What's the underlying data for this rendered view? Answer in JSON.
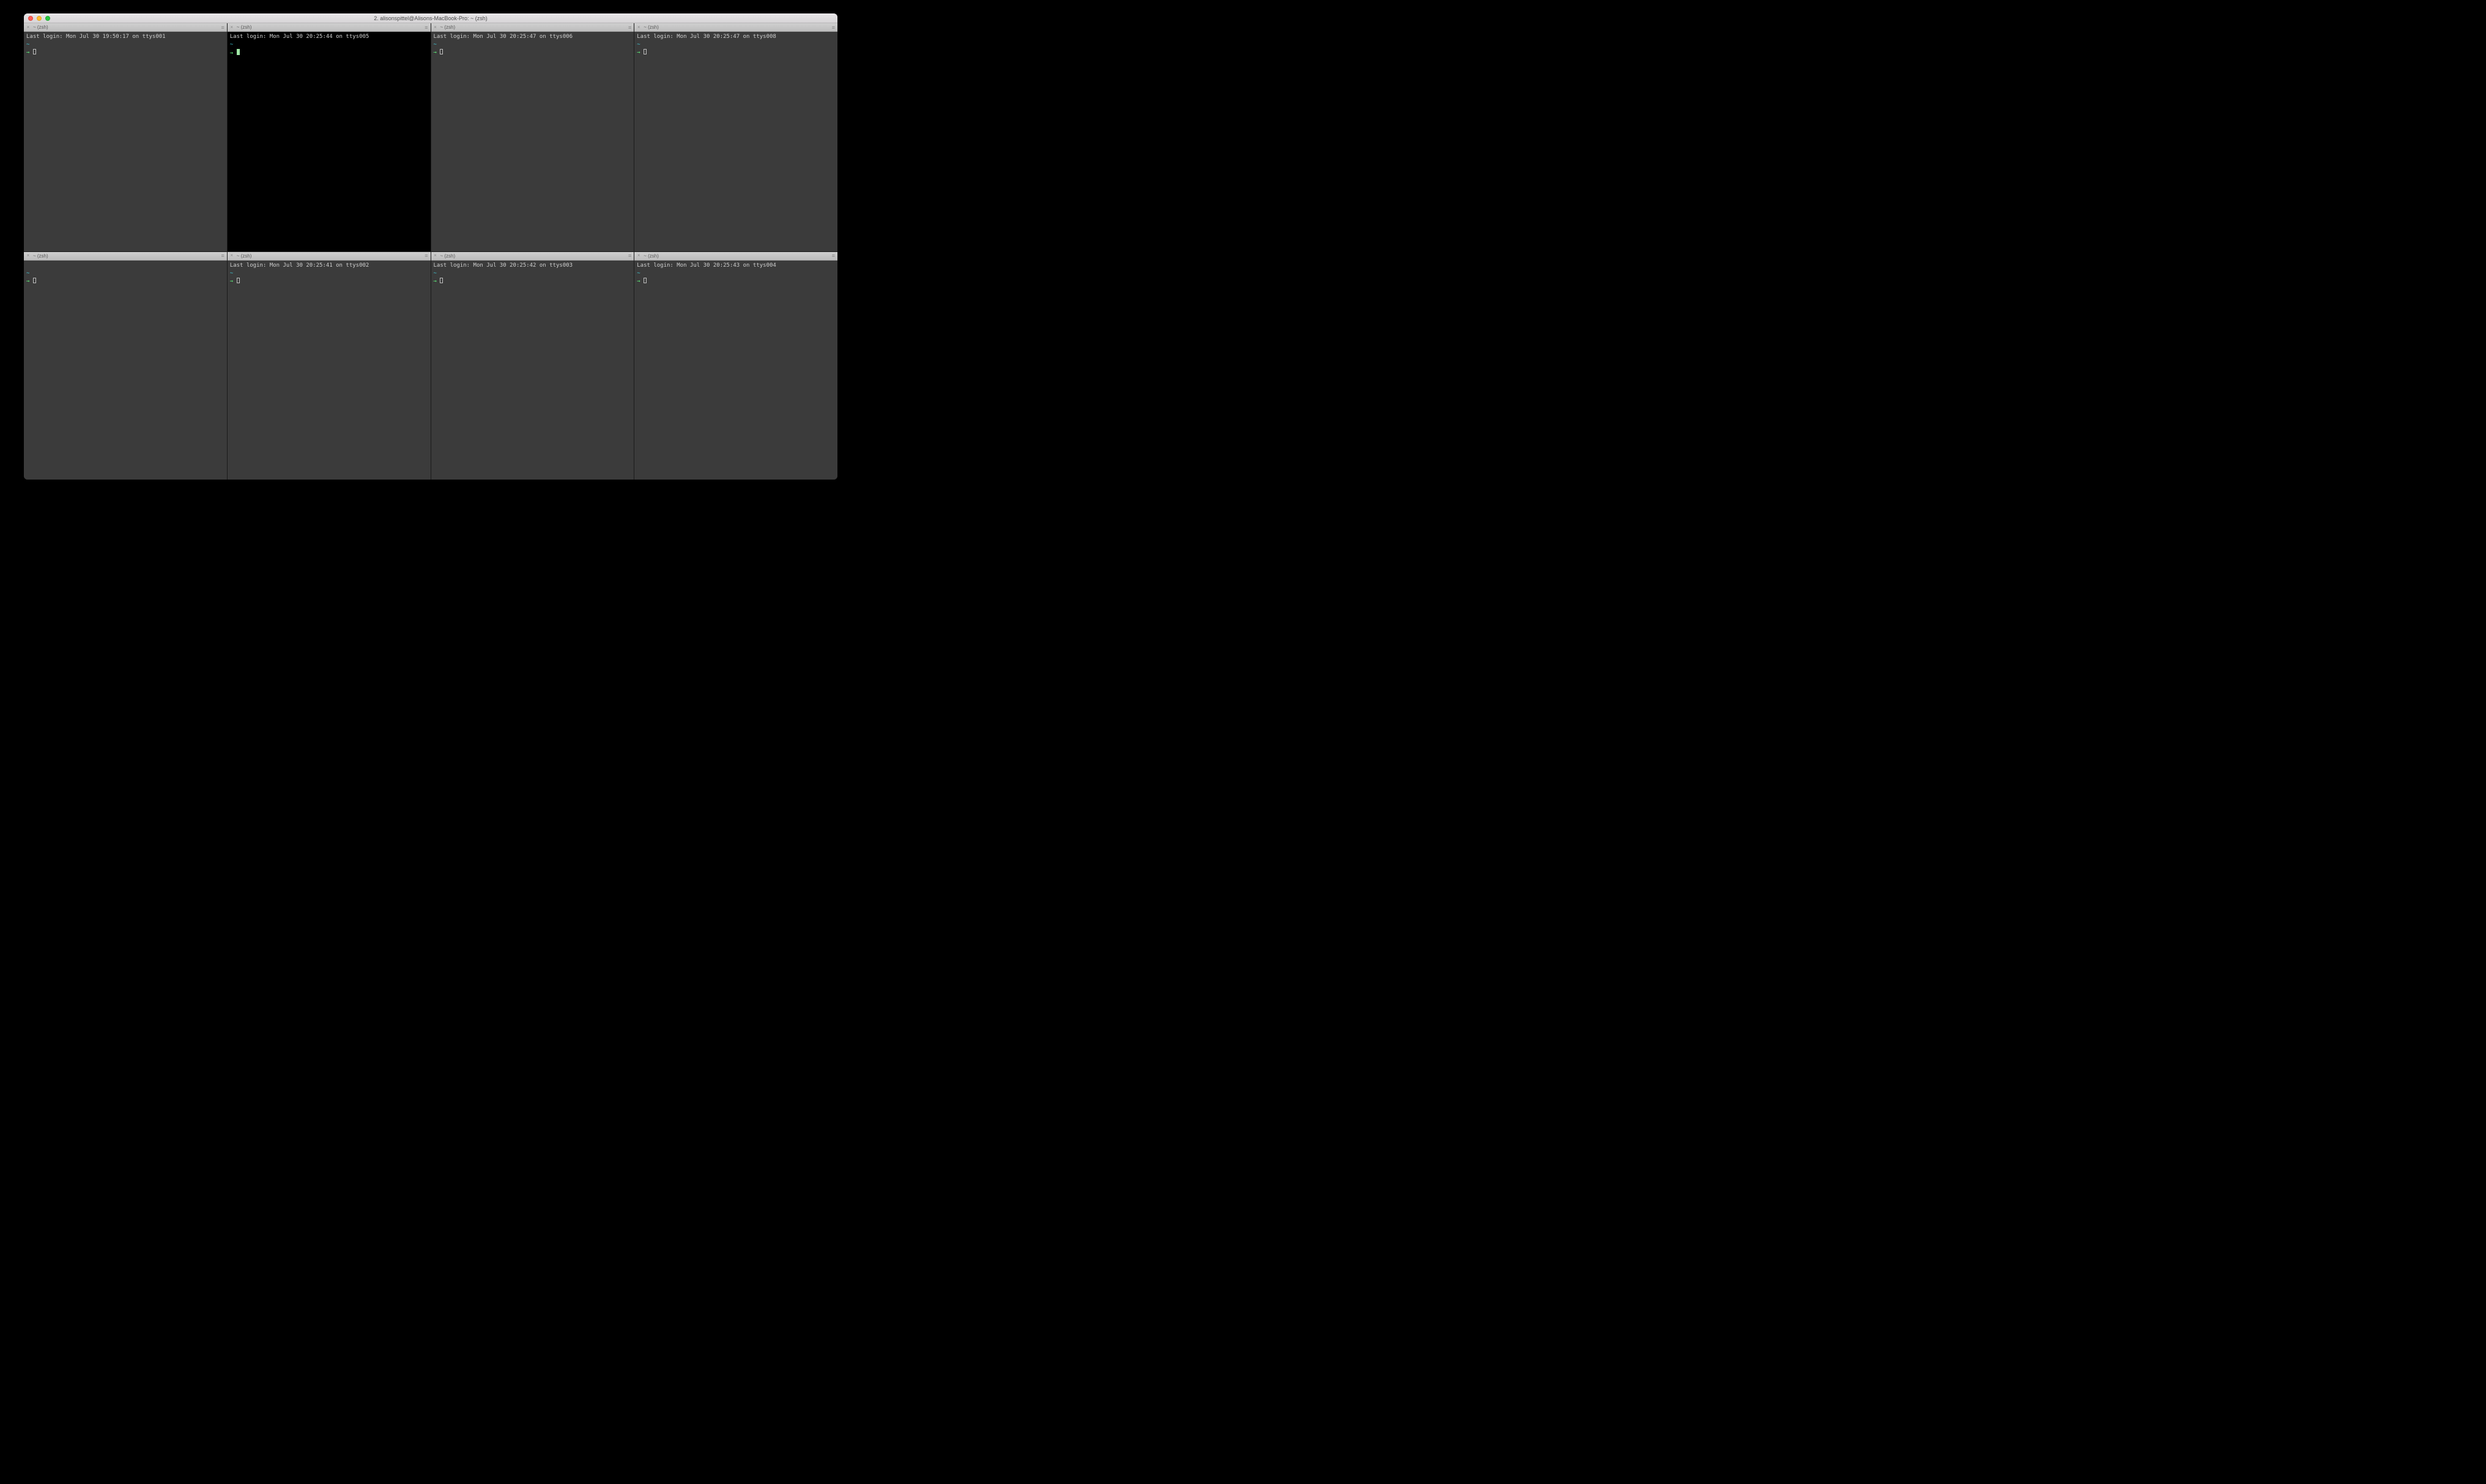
{
  "window": {
    "title": "2. alisonspittel@Alisons-MacBook-Pro: ~ (zsh)"
  },
  "panes": [
    {
      "tab": "~ (zsh)",
      "login": "Last login: Mon Jul 30 19:50:17 on ttys001",
      "active": false
    },
    {
      "tab": "~ (zsh)",
      "login": "Last login: Mon Jul 30 20:25:44 on ttys005",
      "active": true
    },
    {
      "tab": "~ (zsh)",
      "login": "Last login: Mon Jul 30 20:25:47 on ttys006",
      "active": false
    },
    {
      "tab": "~ (zsh)",
      "login": "Last login: Mon Jul 30 20:25:47 on ttys008",
      "active": false
    },
    {
      "tab": "~ (zsh)",
      "login": "",
      "active": false
    },
    {
      "tab": "~ (zsh)",
      "login": "Last login: Mon Jul 30 20:25:41 on ttys002",
      "active": false
    },
    {
      "tab": "~ (zsh)",
      "login": "Last login: Mon Jul 30 20:25:42 on ttys003",
      "active": false
    },
    {
      "tab": "~ (zsh)",
      "login": "Last login: Mon Jul 30 20:25:43 on ttys004",
      "active": false
    }
  ],
  "prompt": {
    "tilde": "~",
    "arrow": "→"
  }
}
